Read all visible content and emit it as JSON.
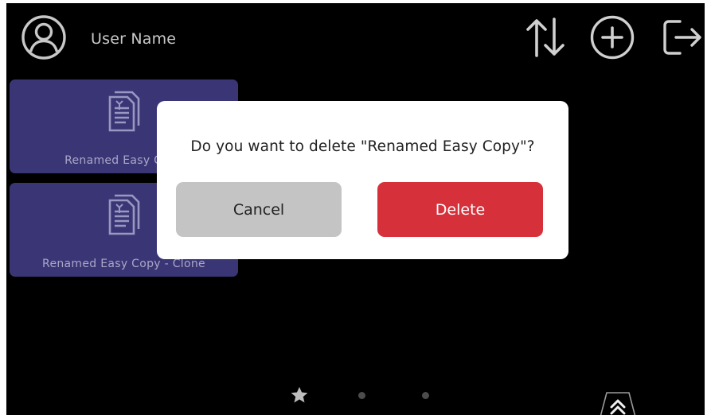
{
  "header": {
    "user_name": "User Name",
    "icons": [
      "user-avatar-icon",
      "sort-icon",
      "add-icon",
      "logout-icon"
    ]
  },
  "tiles": [
    {
      "label": "Renamed Easy Copy",
      "icon": "document-copy-icon"
    },
    {
      "label": "Renamed Easy Copy - Clone",
      "icon": "document-copy-icon"
    }
  ],
  "dialog": {
    "message": "Do you want to delete \"Renamed Easy Copy\"?",
    "cancel_label": "Cancel",
    "delete_label": "Delete"
  },
  "pager": {
    "page_count": 3,
    "current": 1,
    "first_icon": "star-icon"
  },
  "colors": {
    "background": "#000000",
    "tile": "#3a3675",
    "delete": "#d6303b",
    "cancel": "#c4c4c4"
  }
}
